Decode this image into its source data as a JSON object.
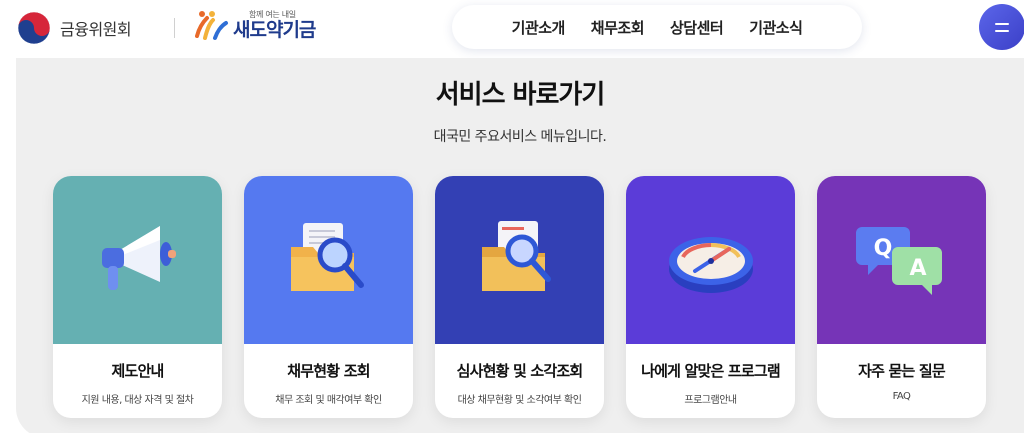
{
  "header": {
    "fsc_logo_text": "금융위원회",
    "sd_logo_sub": "함께 여는 내일",
    "sd_logo_main": "새도약기금",
    "nav": [
      "기관소개",
      "채무조회",
      "상담센터",
      "기관소식"
    ],
    "menu_icon": "menu-icon"
  },
  "section": {
    "title": "서비스 바로가기",
    "subtitle": "대국민 주요서비스 메뉴입니다."
  },
  "cards": [
    {
      "title": "제도안내",
      "desc": "지원 내용, 대상 자격 및 절차",
      "color": "#65b0b2",
      "icon": "megaphone-icon"
    },
    {
      "title": "채무현황 조회",
      "desc": "채무 조회 및 매각여부 확인",
      "color": "#5579f0",
      "icon": "folder-search-icon"
    },
    {
      "title": "심사현황 및 소각조회",
      "desc": "대상 채무현황 및 소각여부 확인",
      "color": "#3340b4",
      "icon": "folder-review-icon"
    },
    {
      "title": "나에게 알맞은 프로그램",
      "desc": "프로그램안내",
      "color": "#5b3cd8",
      "icon": "compass-icon"
    },
    {
      "title": "자주 묻는 질문",
      "desc": "FAQ",
      "color": "#7634b7",
      "icon": "qa-bubble-icon"
    }
  ]
}
